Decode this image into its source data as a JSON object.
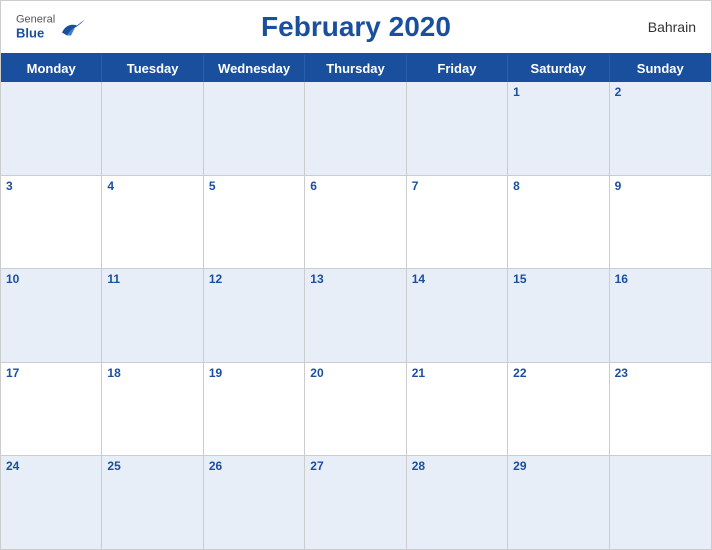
{
  "header": {
    "title": "February 2020",
    "country": "Bahrain",
    "logo": {
      "general": "General",
      "blue": "Blue"
    }
  },
  "dayHeaders": [
    "Monday",
    "Tuesday",
    "Wednesday",
    "Thursday",
    "Friday",
    "Saturday",
    "Sunday"
  ],
  "weeks": [
    [
      {
        "day": null,
        "empty": true
      },
      {
        "day": null,
        "empty": true
      },
      {
        "day": null,
        "empty": true
      },
      {
        "day": null,
        "empty": true
      },
      {
        "day": null,
        "empty": true
      },
      {
        "day": "1",
        "empty": false
      },
      {
        "day": "2",
        "empty": false
      }
    ],
    [
      {
        "day": "3",
        "empty": false
      },
      {
        "day": "4",
        "empty": false
      },
      {
        "day": "5",
        "empty": false
      },
      {
        "day": "6",
        "empty": false
      },
      {
        "day": "7",
        "empty": false
      },
      {
        "day": "8",
        "empty": false
      },
      {
        "day": "9",
        "empty": false
      }
    ],
    [
      {
        "day": "10",
        "empty": false
      },
      {
        "day": "11",
        "empty": false
      },
      {
        "day": "12",
        "empty": false
      },
      {
        "day": "13",
        "empty": false
      },
      {
        "day": "14",
        "empty": false
      },
      {
        "day": "15",
        "empty": false
      },
      {
        "day": "16",
        "empty": false
      }
    ],
    [
      {
        "day": "17",
        "empty": false
      },
      {
        "day": "18",
        "empty": false
      },
      {
        "day": "19",
        "empty": false
      },
      {
        "day": "20",
        "empty": false
      },
      {
        "day": "21",
        "empty": false
      },
      {
        "day": "22",
        "empty": false
      },
      {
        "day": "23",
        "empty": false
      }
    ],
    [
      {
        "day": "24",
        "empty": false
      },
      {
        "day": "25",
        "empty": false
      },
      {
        "day": "26",
        "empty": false
      },
      {
        "day": "27",
        "empty": false
      },
      {
        "day": "28",
        "empty": false
      },
      {
        "day": "29",
        "empty": false
      },
      {
        "day": null,
        "empty": true
      }
    ]
  ]
}
